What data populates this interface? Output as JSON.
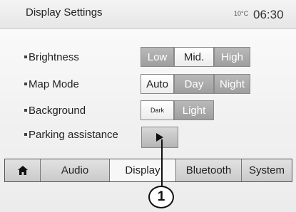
{
  "header": {
    "title": "Display Settings",
    "temperature": "10°C",
    "time": "06:30"
  },
  "settings": {
    "brightness": {
      "label": "Brightness",
      "options": [
        "Low",
        "Mid.",
        "High"
      ],
      "selected": "Mid."
    },
    "map_mode": {
      "label": "Map Mode",
      "options": [
        "Auto",
        "Day",
        "Night"
      ],
      "selected": "Auto"
    },
    "background": {
      "label": "Background",
      "options": [
        "Dark",
        "Light"
      ],
      "selected": "Dark"
    },
    "parking_assistance": {
      "label": "Parking assistance",
      "button_icon": "play-icon"
    }
  },
  "tabs": {
    "home_icon": "home-icon",
    "items": [
      "Audio",
      "Display",
      "Bluetooth",
      "System"
    ],
    "active": "Display"
  },
  "callout": {
    "number": "1"
  }
}
